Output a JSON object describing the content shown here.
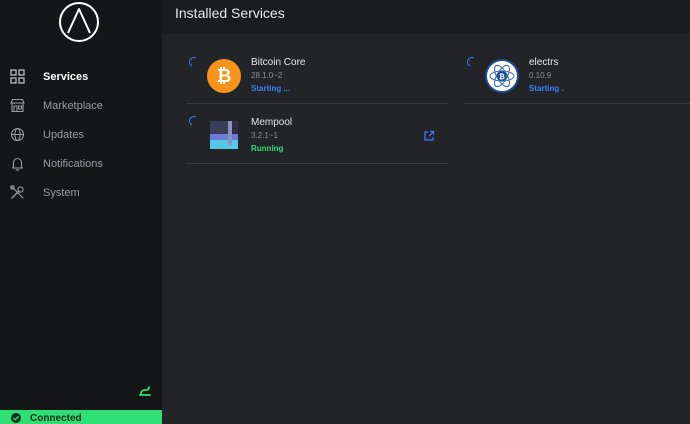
{
  "header": {
    "title": "Installed Services"
  },
  "sidebar": {
    "items": [
      {
        "label": "Services",
        "icon": "grid-icon",
        "active": true
      },
      {
        "label": "Marketplace",
        "icon": "storefront-icon",
        "active": false
      },
      {
        "label": "Updates",
        "icon": "globe-icon",
        "active": false
      },
      {
        "label": "Notifications",
        "icon": "bell-icon",
        "active": false
      },
      {
        "label": "System",
        "icon": "tools-icon",
        "active": false
      }
    ],
    "connection_status": "Connected"
  },
  "services": [
    {
      "name": "Bitcoin Core",
      "version": "28.1.0~2",
      "status": "Starting ...",
      "status_color": "#3880ff",
      "icon": "bitcoin-icon"
    },
    {
      "name": "electrs",
      "version": "0.10.9",
      "status": "Starting .",
      "status_color": "#3880ff",
      "icon": "electrs-icon"
    },
    {
      "name": "Mempool",
      "version": "3.2.1~1",
      "status": "Running",
      "status_color": "#2fdf75",
      "icon": "mempool-icon"
    }
  ],
  "colors": {
    "accent": "#3880ff",
    "success": "#2fdf75",
    "sidebar_bg": "#151618",
    "main_bg": "#222428"
  }
}
